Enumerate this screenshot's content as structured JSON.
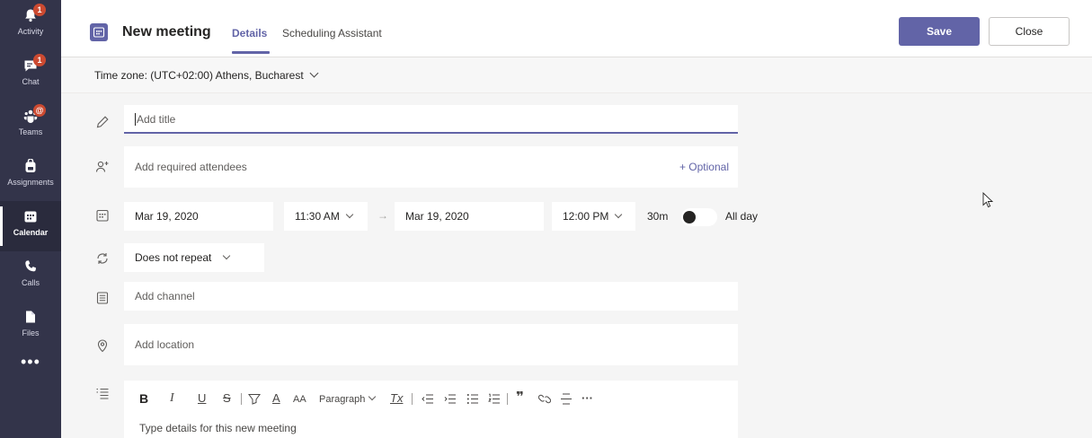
{
  "appbar": {
    "items": [
      {
        "label": "Activity",
        "badge": "1"
      },
      {
        "label": "Chat",
        "badge": "1"
      },
      {
        "label": "Teams",
        "badge": "@"
      },
      {
        "label": "Assignments"
      },
      {
        "label": "Calendar"
      },
      {
        "label": "Calls"
      },
      {
        "label": "Files"
      }
    ],
    "more": "•••"
  },
  "header": {
    "title": "New meeting",
    "tabs": [
      "Details",
      "Scheduling Assistant"
    ],
    "save_label": "Save",
    "close_label": "Close"
  },
  "timezone": "Time zone: (UTC+02:00) Athens, Bucharest",
  "form": {
    "title_placeholder": "Add title",
    "attendees_placeholder": "Add required attendees",
    "optional_label": "+ Optional",
    "start_date": "Mar 19, 2020",
    "start_time": "11:30 AM",
    "end_date": "Mar 19, 2020",
    "end_time": "12:00 PM",
    "duration": "30m",
    "allday_label": "All day",
    "repeat": "Does not repeat",
    "channel_placeholder": "Add channel",
    "location_placeholder": "Add location",
    "details_placeholder": "Type details for this new meeting"
  },
  "toolbar": {
    "bold": "B",
    "italic": "I",
    "underline": "U",
    "strike": "S",
    "font_color": "A",
    "font_size": "AA",
    "paragraph": "Paragraph",
    "clear_format": "Tx",
    "quote": "❞",
    "more": "···"
  },
  "colors": {
    "accent": "#6264a7",
    "appbar": "#33344a",
    "badge": "#cc4a31"
  }
}
